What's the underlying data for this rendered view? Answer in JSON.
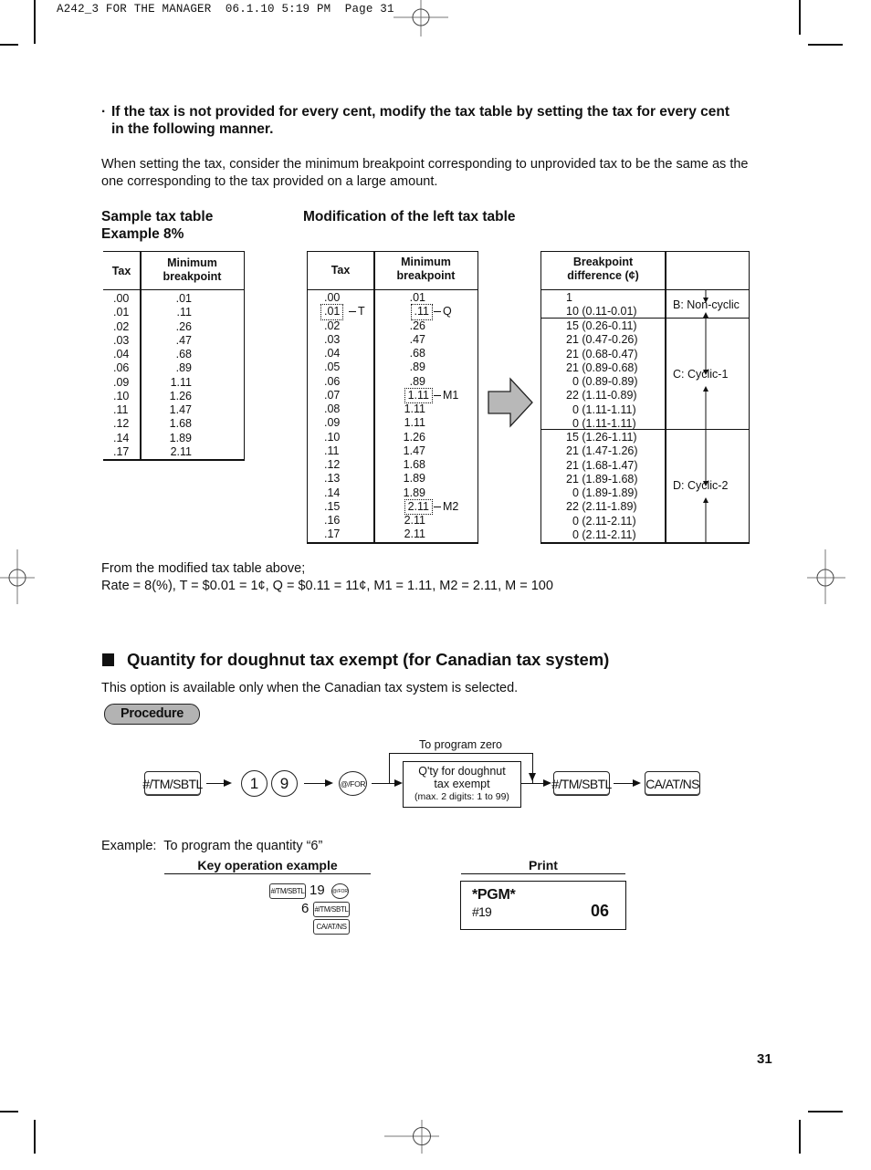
{
  "print_header": "A242_3 FOR THE MANAGER  06.1.10 5:19 PM  Page 31",
  "intro": {
    "bullet": "·",
    "bold_line1": "If the tax is not provided for every cent, modify the tax table by setting the tax for every cent",
    "bold_line2": "in the following manner.",
    "para_line1": "When setting the tax, consider the minimum breakpoint corresponding to unprovided tax to be the same as the",
    "para_line2": "one corresponding to the tax provided on a large amount."
  },
  "sample_table": {
    "title_line1": "Sample tax table",
    "title_line2": "Example 8%",
    "headers": [
      "Tax",
      "Minimum",
      "breakpoint"
    ],
    "tax": ".00\n.01\n.02\n.03\n.04\n.06\n.09\n.10\n.11\n.12\n.14\n.17",
    "breakpoint": ".01\n.11\n.26\n.47\n.68\n.89\n1.11\n1.26\n1.47\n1.68\n1.89\n2.11"
  },
  "modified_table": {
    "title": "Modification of the left tax table",
    "headers": [
      "Tax",
      "Minimum",
      "breakpoint"
    ],
    "rows": [
      {
        "tax": ".00",
        "bp": ".01"
      },
      {
        "tax": ".01",
        "bp": ".11",
        "tax_tag": "T",
        "bp_tag": "Q"
      },
      {
        "tax": ".02",
        "bp": ".26"
      },
      {
        "tax": ".03",
        "bp": ".47"
      },
      {
        "tax": ".04",
        "bp": ".68"
      },
      {
        "tax": ".05",
        "bp": ".89"
      },
      {
        "tax": ".06",
        "bp": ".89"
      },
      {
        "tax": ".07",
        "bp": "1.11",
        "bp_tag": "M1"
      },
      {
        "tax": ".08",
        "bp": "1.11"
      },
      {
        "tax": ".09",
        "bp": "1.11"
      },
      {
        "tax": ".10",
        "bp": "1.26"
      },
      {
        "tax": ".11",
        "bp": "1.47"
      },
      {
        "tax": ".12",
        "bp": "1.68"
      },
      {
        "tax": ".13",
        "bp": "1.89"
      },
      {
        "tax": ".14",
        "bp": "1.89"
      },
      {
        "tax": ".15",
        "bp": "2.11",
        "bp_tag": "M2"
      },
      {
        "tax": ".16",
        "bp": "2.11"
      },
      {
        "tax": ".17",
        "bp": "2.11"
      }
    ]
  },
  "diff_table": {
    "header_line1": "Breakpoint",
    "header_line2": "difference (¢)",
    "groups": [
      {
        "label": "B: Non-cyclic",
        "rows": "1\n10 (0.11-0.01)"
      },
      {
        "label": "C: Cyclic-1",
        "rows": "15 (0.26-0.11)\n21 (0.47-0.26)\n21 (0.68-0.47)\n21 (0.89-0.68)\n  0 (0.89-0.89)\n22 (1.11-0.89)\n  0 (1.11-1.11)\n  0 (1.11-1.11)"
      },
      {
        "label": "D: Cyclic-2",
        "rows": "15 (1.26-1.11)\n21 (1.47-1.26)\n21 (1.68-1.47)\n21 (1.89-1.68)\n  0 (1.89-1.89)\n22 (2.11-1.89)\n  0 (2.11-2.11)\n  0 (2.11-2.11)"
      }
    ]
  },
  "summary": {
    "line1": "From the modified tax table above;",
    "line2": "Rate = 8(%), T = $0.01 = 1¢, Q = $0.11 = 11¢, M1 = 1.11, M2 = 2.11, M = 100"
  },
  "section": {
    "title": "Quantity for doughnut tax exempt (for Canadian tax system)",
    "note": "This option is available only when the Canadian tax system is selected.",
    "procedure_label": "Procedure"
  },
  "flow": {
    "key_tm_sbtl": "#/TM/SBTL",
    "num1": "1",
    "num2": "9",
    "key_for": "@/FOR",
    "zero_label": "To program zero",
    "box_line1": "Q'ty for doughnut",
    "box_line2": "tax exempt",
    "box_line3": "(max. 2 digits: 1 to 99)",
    "key_tm_sbtl2": "#/TM/SBTL",
    "key_ca": "CA/AT/NS"
  },
  "example": {
    "label": "Example:  To program the quantity “6”",
    "key_op_header": "Key operation example",
    "print_header": "Print",
    "op_line1_num": "19",
    "op_line2_num": "6",
    "key_tm": "#/TM/SBTL",
    "key_for": "@/FOR",
    "key_ca": "CA/AT/NS",
    "receipt_line1": "*PGM*",
    "receipt_line2_left": "#19",
    "receipt_line2_right": "06"
  },
  "page_number": "31"
}
